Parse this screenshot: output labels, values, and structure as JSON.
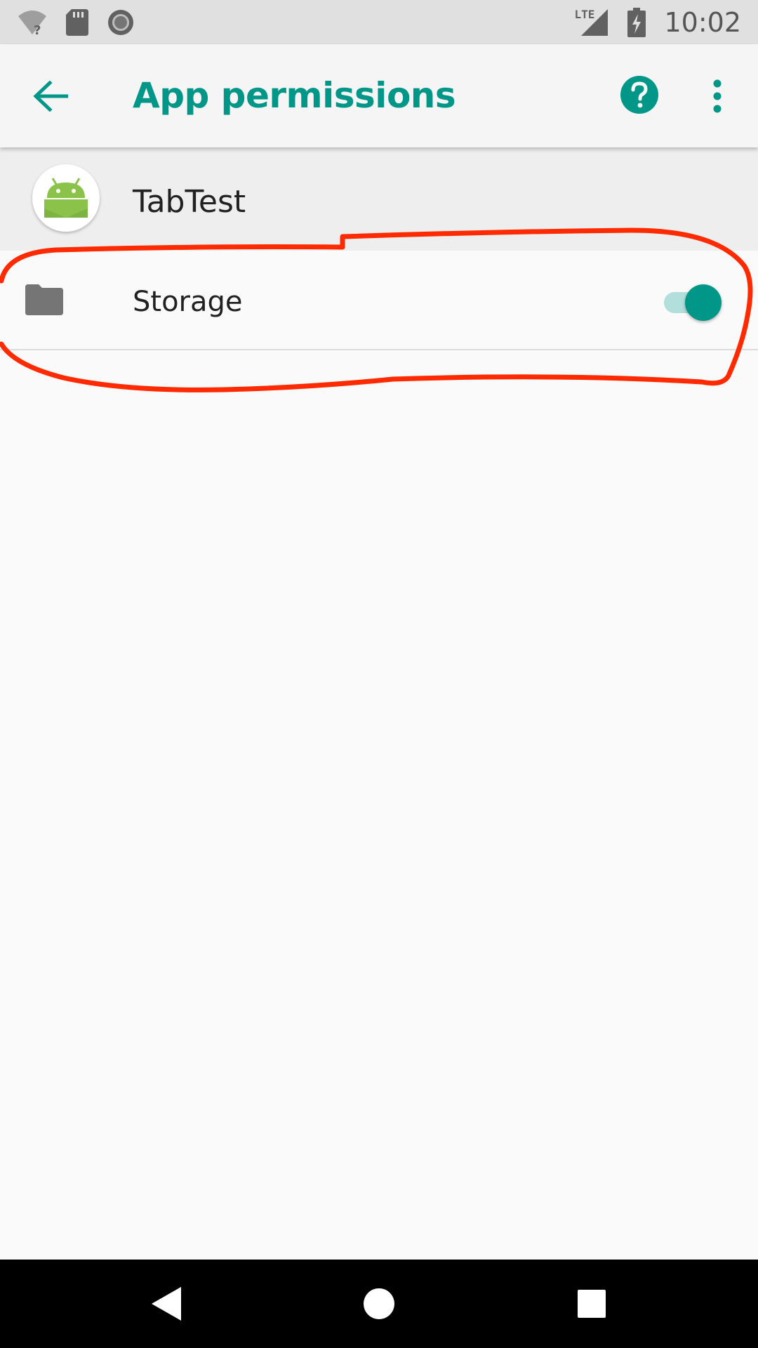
{
  "status_bar": {
    "time": "10:02",
    "network_label": "LTE",
    "icons_left": [
      "wifi-unknown-icon",
      "sd-card-icon",
      "record-icon"
    ],
    "icons_right": [
      "lte-signal-icon",
      "battery-charging-icon"
    ]
  },
  "toolbar": {
    "title": "App permissions",
    "back_icon": "arrow-back-icon",
    "help_icon": "help-icon",
    "more_icon": "more-vert-icon",
    "accent": "#009688"
  },
  "app": {
    "name": "TabTest",
    "icon": "android-icon",
    "icon_color": "#8bc34a"
  },
  "permissions": [
    {
      "label": "Storage",
      "icon": "folder-icon",
      "enabled": true
    }
  ],
  "annotation": {
    "shape": "freehand-outline",
    "color": "#ff2a00",
    "target": "Storage"
  },
  "nav_bar": {
    "buttons": [
      "back-triangle-icon",
      "home-circle-icon",
      "recents-square-icon"
    ]
  }
}
